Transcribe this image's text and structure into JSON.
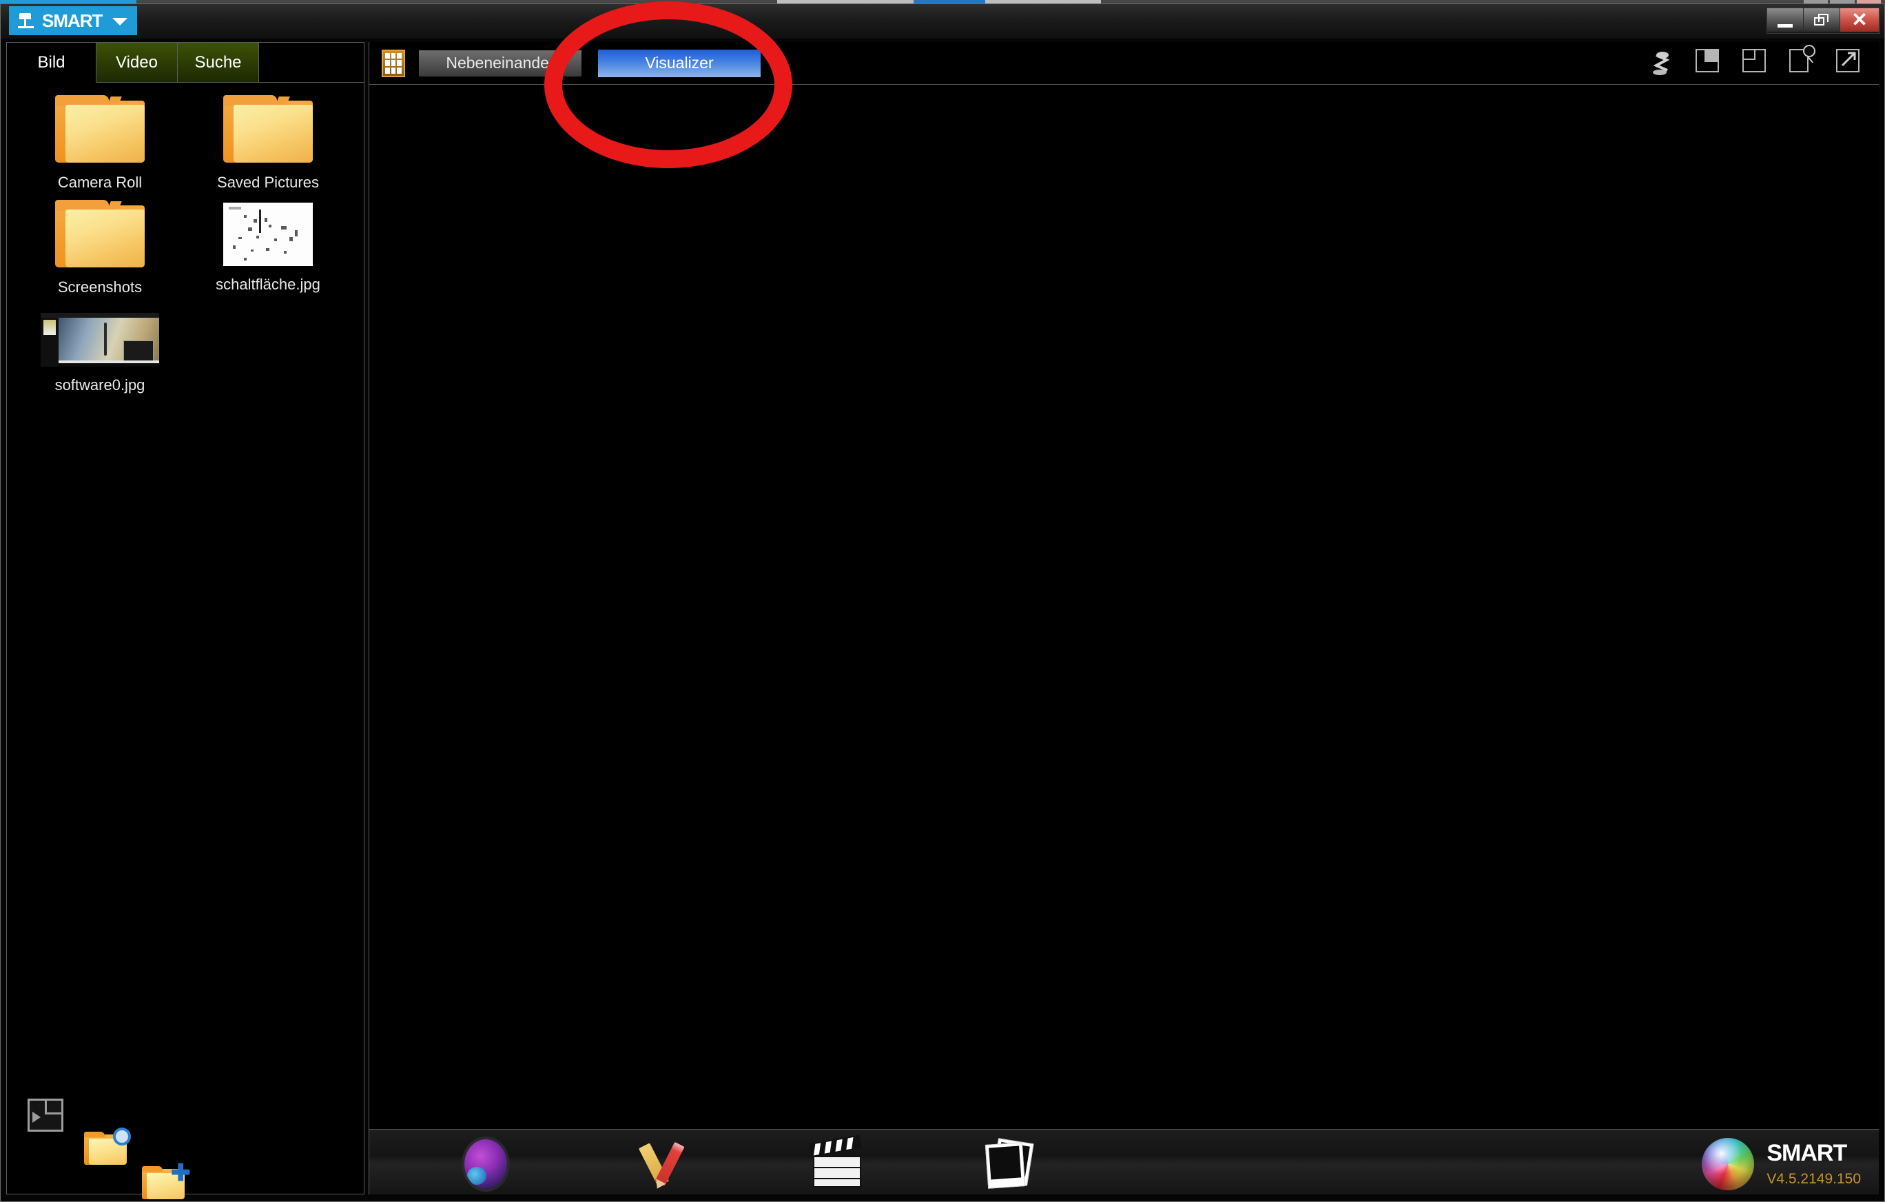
{
  "desktop": {
    "taskbar_present": true
  },
  "window": {
    "brand_button_label": "SMART",
    "controls": {
      "minimize": "Minimize",
      "restore": "Restore",
      "close": "Close"
    }
  },
  "sidebar": {
    "tabs": [
      {
        "label": "Bild",
        "active": true
      },
      {
        "label": "Video",
        "active": false
      },
      {
        "label": "Suche",
        "active": false
      }
    ],
    "files": [
      {
        "name": "Camera Roll",
        "type": "folder"
      },
      {
        "name": "Saved Pictures",
        "type": "folder"
      },
      {
        "name": "Screenshots",
        "type": "folder"
      },
      {
        "name": "schaltfläche.jpg",
        "type": "image"
      },
      {
        "name": "software0.jpg",
        "type": "image"
      }
    ],
    "footer_icons": [
      {
        "name": "panel-layout-icon",
        "label": "Ansicht umschalten"
      },
      {
        "name": "folder-browse-icon",
        "label": "Ordner durchsuchen"
      },
      {
        "name": "folder-add-icon",
        "label": "Ordner hinzufügen"
      }
    ]
  },
  "main": {
    "toolbar": {
      "grid_icon": "grid-view-icon",
      "nebeneinander_label": "Nebeneinander",
      "visualizer_label": "Visualizer",
      "right_icons": [
        {
          "name": "document-camera-icon"
        },
        {
          "name": "layout-corner-icon"
        },
        {
          "name": "layout-split-icon"
        },
        {
          "name": "page-zoom-icon"
        },
        {
          "name": "open-external-icon"
        }
      ]
    },
    "canvas": {
      "content": ""
    },
    "footer_icons": [
      {
        "name": "gallery-icon",
        "label": "Galerie"
      },
      {
        "name": "tools-icon",
        "label": "Werkzeuge"
      },
      {
        "name": "video-icon",
        "label": "Video"
      },
      {
        "name": "photos-icon",
        "label": "Fotos"
      }
    ]
  },
  "brand": {
    "name": "SMART",
    "version": "V4.5.2149.150"
  },
  "annotation": {
    "shape": "ellipse",
    "color": "#e81919",
    "targets": "Visualizer"
  }
}
